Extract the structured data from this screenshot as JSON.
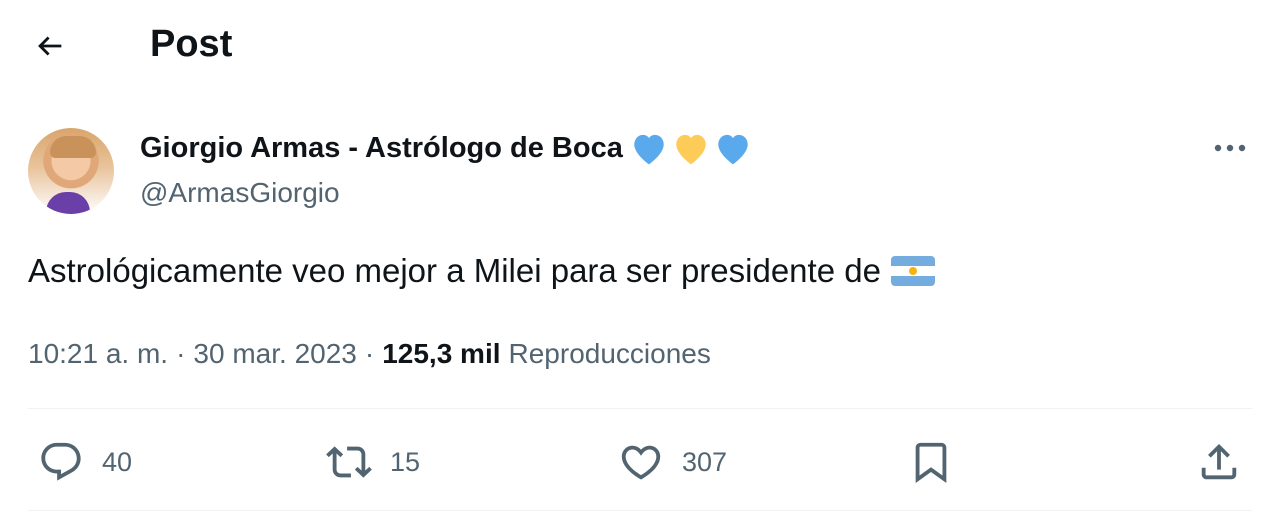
{
  "header": {
    "title": "Post"
  },
  "author": {
    "display_name": "Giorgio Armas - Astrólogo de Boca",
    "name_emojis": [
      "blue-heart",
      "yellow-heart",
      "blue-heart"
    ],
    "username": "@ArmasGiorgio"
  },
  "tweet": {
    "text": "Astrológicamente veo mejor a Milei para ser presidente de",
    "trailing_emoji": "argentina-flag"
  },
  "meta": {
    "time": "10:21 a. m.",
    "separator": "·",
    "date": "30 mar. 2023",
    "views_count": "125,3 mil",
    "views_label": "Reproducciones"
  },
  "actions": {
    "replies": "40",
    "retweets": "15",
    "likes": "307"
  },
  "colors": {
    "text": "#0f1419",
    "secondary": "#536471",
    "divider": "#eff3f4",
    "blue_heart": "#5aa9ec",
    "yellow_heart": "#fdcb58"
  }
}
